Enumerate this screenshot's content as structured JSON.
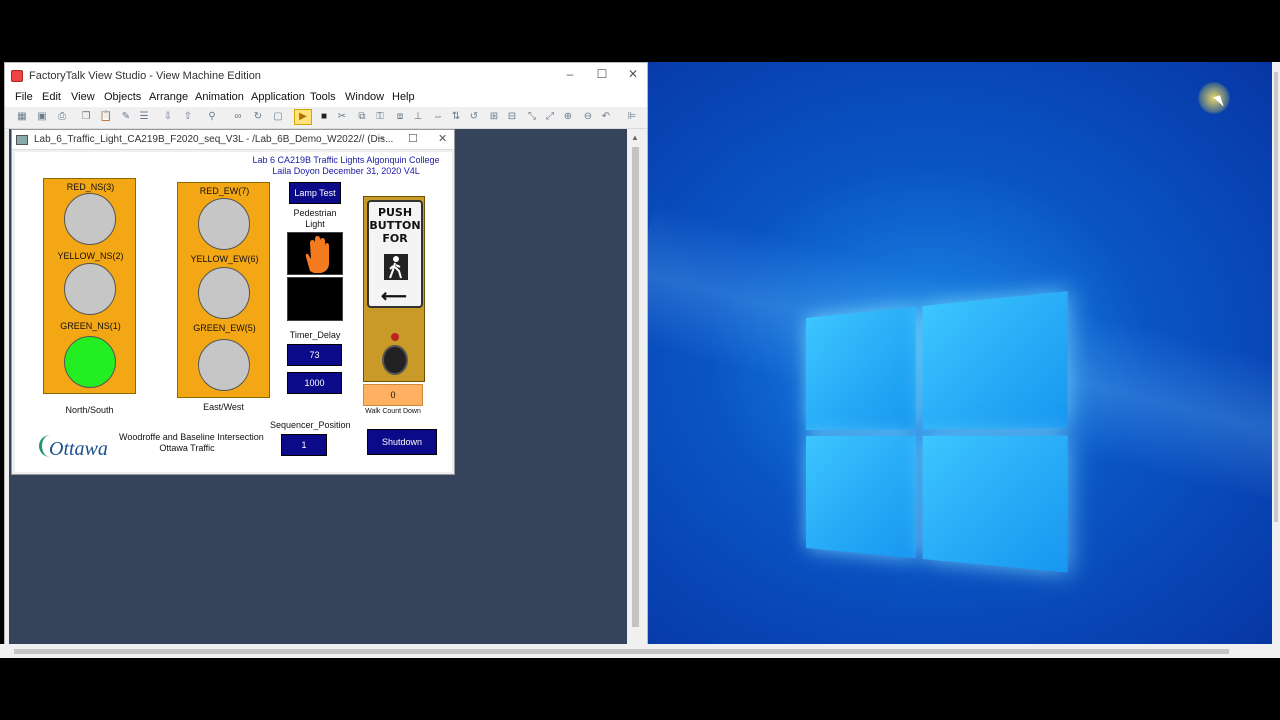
{
  "app": {
    "title": "FactoryTalk View Studio - View Machine Edition",
    "menu": [
      "File",
      "Edit",
      "View",
      "Objects",
      "Arrange",
      "Animation",
      "Application",
      "Tools",
      "Window",
      "Help"
    ],
    "controls": {
      "minimize": "–",
      "maximize": "☐",
      "close": "✕"
    }
  },
  "child": {
    "title": "Lab_6_Traffic_Light_CA219B_F2020_seq_V3L - /Lab_6B_Demo_W2022// (Dis...",
    "controls": {
      "minimize": "–",
      "maximize": "☐",
      "close": "✕"
    }
  },
  "display": {
    "header_line1": "Lab 6 CA219B Traffic Lights Algonquin College",
    "header_line2": "Laila Doyon December 31, 2020 V4L",
    "ns": {
      "red_label": "RED_NS(3)",
      "yellow_label": "YELLOW_NS(2)",
      "green_label": "GREEN_NS(1)",
      "caption": "North/South"
    },
    "ew": {
      "red_label": "RED_EW(7)",
      "yellow_label": "YELLOW_EW(6)",
      "green_label": "GREEN_EW(5)",
      "caption": "East/West"
    },
    "lamp_test": "Lamp Test",
    "pedestrian_label_1": "Pedestrian",
    "pedestrian_label_2": "Light",
    "timer_label": "Timer_Delay",
    "timer_value": "73",
    "timer_preset": "1000",
    "push_sign": {
      "line1": "PUSH",
      "line2": "BUTTON",
      "line3": "FOR"
    },
    "walk_count_value": "0",
    "walk_count_label": "Walk Count Down",
    "sequencer_label": "Sequencer_Position",
    "sequencer_value": "1",
    "intersection_line1": "Woodroffe and Baseline Intersection",
    "intersection_line2": "Ottawa Traffic",
    "ottawa_logo": "Ottawa",
    "shutdown": "Shutdown",
    "colors": {
      "amber": "#f3a714",
      "lamp_off": "#c6c6c6",
      "lamp_green_on": "#22ee22",
      "navy": "#0b0b8a",
      "header_text": "#1a1aa6"
    }
  }
}
